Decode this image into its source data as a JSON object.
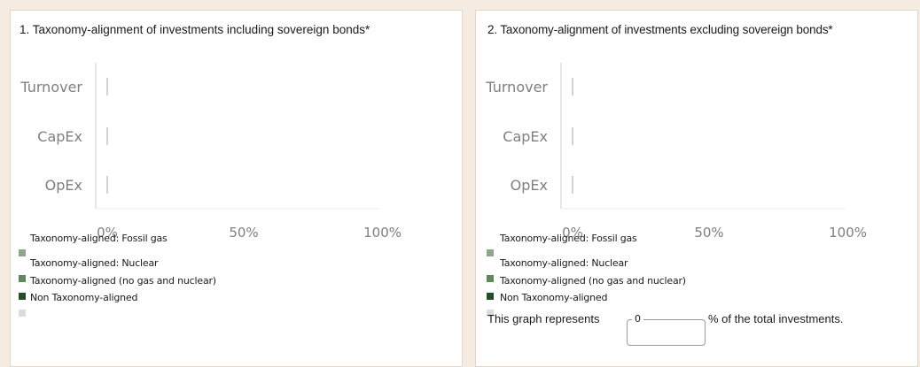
{
  "colors": {
    "gas": "#8fa68a",
    "nuclear": "#5e8a5e",
    "aligned": "#264d2a",
    "non_aligned": "#dcdcdc",
    "axis": "#d0d0d0"
  },
  "chart_data": [
    {
      "type": "bar",
      "orientation": "horizontal",
      "stacked": true,
      "title": "1. Taxonomy-alignment of investments including sovereign bonds*",
      "categories": [
        "Turnover",
        "CapEx",
        "OpEx"
      ],
      "ticks": [
        "0%",
        "50%",
        "100%"
      ],
      "xlim": [
        0,
        100
      ],
      "legend": [
        "Taxonomy-aligned: Fossil gas",
        "Taxonomy-aligned: Nuclear",
        "Taxonomy-aligned (no gas and nuclear)",
        "Non Taxonomy-aligned"
      ],
      "series": [
        {
          "name": "Taxonomy-aligned: Fossil gas",
          "values": [
            0,
            0,
            0
          ]
        },
        {
          "name": "Taxonomy-aligned: Nuclear",
          "values": [
            0,
            0,
            0
          ]
        },
        {
          "name": "Taxonomy-aligned (no gas and nuclear)",
          "values": [
            0,
            0,
            0
          ]
        },
        {
          "name": "Non Taxonomy-aligned",
          "values": [
            0,
            0,
            0
          ]
        }
      ]
    },
    {
      "type": "bar",
      "orientation": "horizontal",
      "stacked": true,
      "title": "2. Taxonomy-alignment of investments excluding sovereign bonds*",
      "categories": [
        "Turnover",
        "CapEx",
        "OpEx"
      ],
      "ticks": [
        "0%",
        "50%",
        "100%"
      ],
      "xlim": [
        0,
        100
      ],
      "legend": [
        "Taxonomy-aligned: Fossil gas",
        "Taxonomy-aligned: Nuclear",
        "Taxonomy-aligned (no gas and nuclear)",
        "Non Taxonomy-aligned"
      ],
      "series": [
        {
          "name": "Taxonomy-aligned: Fossil gas",
          "values": [
            0,
            0,
            0
          ]
        },
        {
          "name": "Taxonomy-aligned: Nuclear",
          "values": [
            0,
            0,
            0
          ]
        },
        {
          "name": "Taxonomy-aligned (no gas and nuclear)",
          "values": [
            0,
            0,
            0
          ]
        },
        {
          "name": "Non Taxonomy-aligned",
          "values": [
            0,
            0,
            0
          ]
        }
      ]
    }
  ],
  "footer": {
    "prefix": "This graph represents",
    "value": "0",
    "suffix": "% of the total investments."
  }
}
